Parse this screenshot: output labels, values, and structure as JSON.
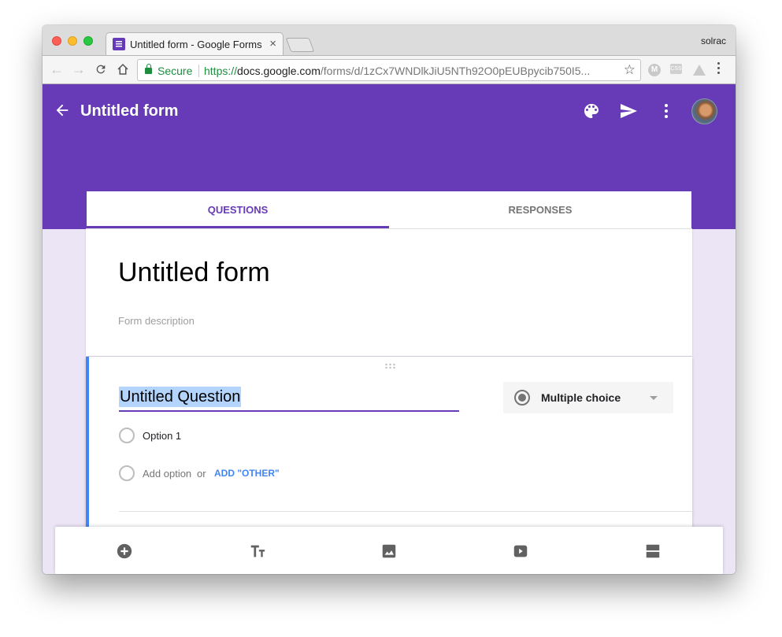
{
  "browser": {
    "tab_title": "Untitled form - Google Forms",
    "tab_close": "×",
    "profile_name": "solrac",
    "security_label": "Secure",
    "url_scheme": "https://",
    "url_host": "docs.google.com",
    "url_path": "/forms/d/1zCx7WNDlkJiU5NTh92O0pEUBpycib750I5...",
    "nav": {
      "back": "←",
      "forward": "→",
      "reload": "C",
      "home": "⌂"
    },
    "star": "☆",
    "extensions": [
      {
        "name": "m-extension",
        "label": "M"
      },
      {
        "name": "css-extension",
        "label": "CSS"
      },
      {
        "name": "drive-extension",
        "label": ""
      }
    ]
  },
  "header": {
    "title": "Untitled form",
    "actions": [
      "palette",
      "send",
      "more"
    ]
  },
  "form_tabs": [
    {
      "label": "QUESTIONS",
      "active": true
    },
    {
      "label": "RESPONSES",
      "active": false
    }
  ],
  "form": {
    "title": "Untitled form",
    "description_placeholder": "Form description"
  },
  "question": {
    "title": "Untitled Question",
    "type": "Multiple choice",
    "options": [
      {
        "label": "Option 1"
      }
    ],
    "add_option_label": "Add option",
    "or_label": "or",
    "add_other_label": "ADD \"OTHER\""
  },
  "bottom_toolbar": [
    {
      "name": "add-question",
      "icon": "add-circle-icon"
    },
    {
      "name": "add-title-description",
      "icon": "text-size-icon"
    },
    {
      "name": "add-image",
      "icon": "image-icon"
    },
    {
      "name": "add-video",
      "icon": "video-icon"
    },
    {
      "name": "add-section",
      "icon": "section-icon"
    }
  ],
  "colors": {
    "brand": "#673ab7",
    "background": "#ebe5f6",
    "accent_blue": "#4285f4",
    "secure_green": "#1e8e3e"
  }
}
